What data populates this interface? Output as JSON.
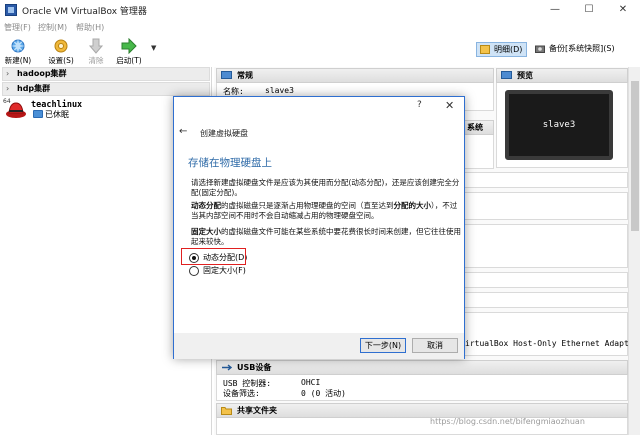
{
  "window": {
    "title": "Oracle VM VirtualBox 管理器",
    "minimize": "—",
    "maximize": "☐",
    "close": "✕"
  },
  "menu": [
    "管理(F)",
    "控制(M)",
    "帮助(H)"
  ],
  "toolbar": {
    "new": "新建(N)",
    "settings": "设置(S)",
    "discard": "清除",
    "start": "启动(T)"
  },
  "views": {
    "details": "明细(D)",
    "snapshots": "备份[系统快照](S)"
  },
  "vm_list": {
    "groups": [
      "hadoop集群",
      "hdp集群"
    ],
    "vm": {
      "badge": "64",
      "name": "teachlinux",
      "state": "已休眠"
    }
  },
  "details": {
    "general": {
      "header": "常规",
      "name_label": "名称:",
      "name_value": "slave3"
    },
    "system": {
      "header_partial": "系统"
    },
    "preview": {
      "header": "预览",
      "screen_text": "slave3"
    },
    "network": {
      "adapter_tail": "irtualBox Host-Only Ethernet Adapter"
    },
    "usb": {
      "header": "USB设备",
      "controller_label": "USB 控制器:",
      "controller_value": "OHCI",
      "filter_label": "设备筛选:",
      "filter_value": "0 (0 活动)"
    },
    "shared": {
      "header": "共享文件夹"
    }
  },
  "dialog": {
    "help": "?",
    "close": "✕",
    "back": "←",
    "title": "创建虚拟硬盘",
    "heading": "存储在物理硬盘上",
    "intro": "请选择新建虚拟硬盘文件是应该为其使用而分配(动态分配)，还是应该创建完全分配(固定分配)。",
    "dynamic_desc_bold": "动态分配",
    "dynamic_desc_1": "的虚拟磁盘只是逐渐占用物理硬盘的空间（直至达到",
    "dynamic_desc_bold2": "分配的大小",
    "dynamic_desc_2": "），不过当其内部空间不用时不会自动缩减占用的物理硬盘空间。",
    "fixed_desc_bold": "固定大小",
    "fixed_desc": "的虚拟磁盘文件可能在某些系统中要花费很长时间来创建，但它往往使用起来较快。",
    "option_dynamic": "动态分配(D)",
    "option_fixed": "固定大小(F)",
    "selected": "dynamic",
    "next": "下一步(N)",
    "cancel": "取消"
  },
  "watermark": "https://blog.csdn.net/bifengmiaozhuan"
}
